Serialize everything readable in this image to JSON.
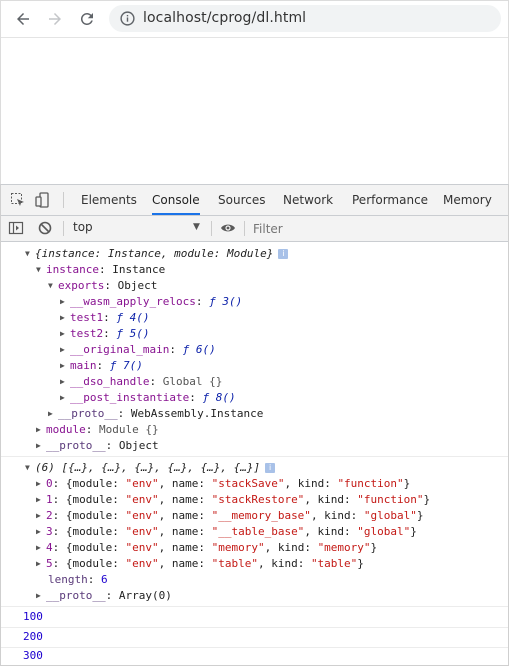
{
  "browser": {
    "url": "localhost/cprog/dl.html"
  },
  "devtools": {
    "tabs": [
      "Elements",
      "Console",
      "Sources",
      "Network",
      "Performance",
      "Memory"
    ],
    "active_tab": "Console",
    "context": "top",
    "filter_placeholder": "Filter"
  },
  "console": {
    "obj1": {
      "summary_a": "{instance: Instance, module: Module}",
      "instance_key": "instance",
      "instance_val": "Instance",
      "exports_key": "exports",
      "exports_val": "Object",
      "exports": [
        {
          "key": "__wasm_apply_relocs",
          "val": "ƒ 3()"
        },
        {
          "key": "test1",
          "val": "ƒ 4()"
        },
        {
          "key": "test2",
          "val": "ƒ 5()"
        },
        {
          "key": "__original_main",
          "val": "ƒ 6()"
        },
        {
          "key": "main",
          "val": "ƒ 7()"
        },
        {
          "key": "__dso_handle",
          "val": "Global {}"
        },
        {
          "key": "__post_instantiate",
          "val": "ƒ 8()"
        }
      ],
      "proto_inst_key": "__proto__",
      "proto_inst_val": "WebAssembly.Instance",
      "module_key": "module",
      "module_val": "Module {}",
      "proto_key": "__proto__",
      "proto_val": "Object"
    },
    "obj2": {
      "summary": "(6) [{…}, {…}, {…}, {…}, {…}, {…}]",
      "items": [
        {
          "idx": "0",
          "name": "\"stackSave\"",
          "kind": "\"function\""
        },
        {
          "idx": "1",
          "name": "\"stackRestore\"",
          "kind": "\"function\""
        },
        {
          "idx": "2",
          "name": "\"__memory_base\"",
          "kind": "\"global\""
        },
        {
          "idx": "3",
          "name": "\"__table_base\"",
          "kind": "\"global\""
        },
        {
          "idx": "4",
          "name": "\"memory\"",
          "kind": "\"memory\""
        },
        {
          "idx": "5",
          "name": "\"table\"",
          "kind": "\"table\""
        }
      ],
      "module_label": "{module: ",
      "module_str": "\"env\"",
      "name_label": ", name: ",
      "kind_label": ", kind: ",
      "length_key": "length",
      "length_val": "6",
      "proto_key": "__proto__",
      "proto_val": "Array(0)"
    },
    "logs": [
      "100",
      "200",
      "300"
    ]
  }
}
